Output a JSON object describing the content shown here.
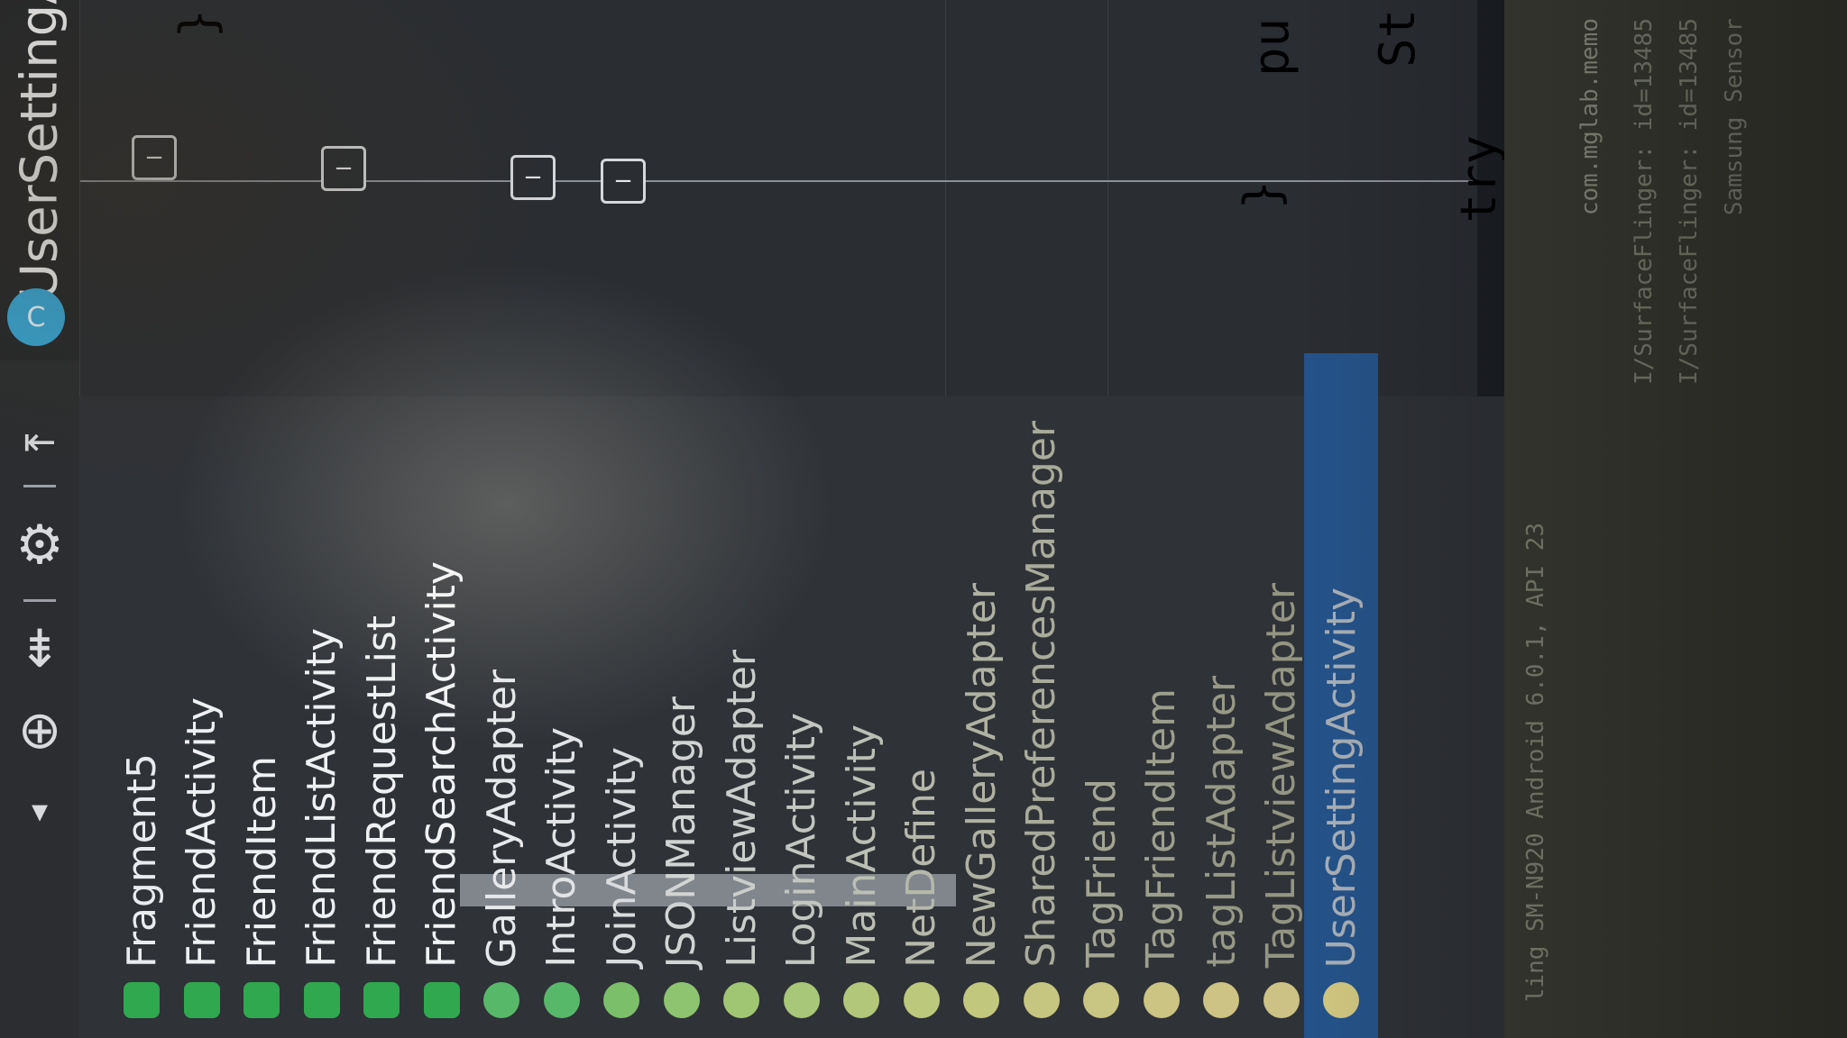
{
  "tab": {
    "title": "UserSettingA",
    "icon": "class-c-icon",
    "icon_letter": "C"
  },
  "toolbar": {
    "items": [
      {
        "name": "dropdown-arrow-icon",
        "glyph": "▾"
      },
      {
        "name": "target-icon",
        "glyph": "⊕"
      },
      {
        "name": "collapse-icon",
        "glyph": "⇟"
      },
      {
        "name": "gear-icon",
        "glyph": "⚙"
      },
      {
        "name": "hide-panel-icon",
        "glyph": "⇤"
      }
    ]
  },
  "tree": {
    "items": [
      {
        "label": "Fragment5",
        "color": "#e9ecef",
        "icon_color": "#2fa84f"
      },
      {
        "label": "FriendActivity",
        "color": "#eef0f2",
        "icon_color": "#2fa84f"
      },
      {
        "label": "FriendItem",
        "color": "#eef0f2",
        "icon_color": "#2fa84f"
      },
      {
        "label": "FriendListActivity",
        "color": "#eef0f2",
        "icon_color": "#2fa84f"
      },
      {
        "label": "FriendRequestList",
        "color": "#eef0f2",
        "icon_color": "#2fa84f"
      },
      {
        "label": "FriendSearchActivity",
        "color": "#f2f3f5",
        "icon_color": "#2fa84f"
      },
      {
        "label": "GalleryAdapter",
        "color": "#e6e8ea",
        "icon_color": "#58b86a"
      },
      {
        "label": "IntroActivity",
        "color": "#e1e3e4",
        "icon_color": "#58b86a"
      },
      {
        "label": "JoinActivity",
        "color": "#d9dbdc",
        "icon_color": "#7cbf6a"
      },
      {
        "label": "JSONManager",
        "color": "#d2d4d2",
        "icon_color": "#8ec36f"
      },
      {
        "label": "ListviewAdapter",
        "color": "#cacdc9",
        "icon_color": "#a1c673"
      },
      {
        "label": "LoginActivity",
        "color": "#c3c6bf",
        "icon_color": "#a8c778"
      },
      {
        "label": "MainActivity",
        "color": "#bcbfb4",
        "icon_color": "#b2c77a"
      },
      {
        "label": "NetDefine",
        "color": "#b5b8aa",
        "icon_color": "#bcc87c"
      },
      {
        "label": "NewGalleryAdapter",
        "color": "#afb2a2",
        "icon_color": "#c2c77e"
      },
      {
        "label": "SharedPreferencesManager",
        "color": "#a9ab9b",
        "icon_color": "#c6c680"
      },
      {
        "label": "TagFriend",
        "color": "#a2a593",
        "icon_color": "#c9c582"
      },
      {
        "label": "TagFriendItem",
        "color": "#9c9f8d",
        "icon_color": "#cbc483"
      },
      {
        "label": "tagListAdapter",
        "color": "#979987",
        "icon_color": "#ccc384"
      },
      {
        "label": "TagListviewAdapter",
        "color": "#939582",
        "icon_color": "#ccc285"
      },
      {
        "label": "UserSettingActivity",
        "color": "#a9b0b8",
        "icon_color": "#d2c882"
      }
    ]
  },
  "editor": {
    "markers": [
      {
        "name": "fold-marker",
        "glyph": "−"
      },
      {
        "name": "fold-marker",
        "glyph": "−"
      },
      {
        "name": "fold-marker",
        "glyph": "−"
      },
      {
        "name": "fold-marker",
        "glyph": "−"
      }
    ],
    "code": [
      {
        "text": "}",
        "color": "#d8d8d8"
      },
      {
        "text": "pu",
        "color": "#e0913a"
      },
      {
        "text": "}",
        "color": "#bdbdbd"
      },
      {
        "text": "St",
        "color": "#9aa0a6"
      },
      {
        "text": "try",
        "color": "#8a7a45"
      }
    ]
  },
  "status": {
    "lines": [
      "ling SM-N920 Android 6.0.1, API 23",
      "com.mglab.memo",
      "I/SurfaceFlinger: id=13485",
      "I/SurfaceFlinger: id=13485",
      "Samsung Sensor"
    ]
  }
}
